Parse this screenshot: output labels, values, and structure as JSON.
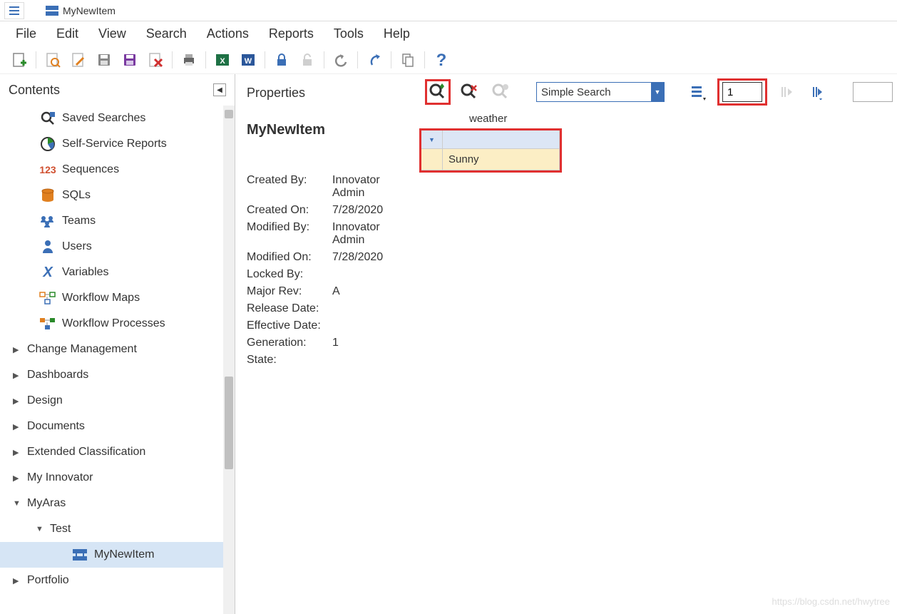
{
  "title": "MyNewItem",
  "menu": {
    "file": "File",
    "edit": "Edit",
    "view": "View",
    "search": "Search",
    "actions": "Actions",
    "reports": "Reports",
    "tools": "Tools",
    "help": "Help"
  },
  "left": {
    "header": "Contents",
    "items": [
      {
        "label": "Saved Searches",
        "kind": "item",
        "level": 1,
        "icon": "saved-search"
      },
      {
        "label": "Self-Service Reports",
        "kind": "item",
        "level": 1,
        "icon": "pie"
      },
      {
        "label": "Sequences",
        "kind": "item",
        "level": 1,
        "icon": "seq"
      },
      {
        "label": "SQLs",
        "kind": "item",
        "level": 1,
        "icon": "db"
      },
      {
        "label": "Teams",
        "kind": "item",
        "level": 1,
        "icon": "teams"
      },
      {
        "label": "Users",
        "kind": "item",
        "level": 1,
        "icon": "user"
      },
      {
        "label": "Variables",
        "kind": "item",
        "level": 1,
        "icon": "var"
      },
      {
        "label": "Workflow Maps",
        "kind": "item",
        "level": 1,
        "icon": "wfm"
      },
      {
        "label": "Workflow Processes",
        "kind": "item",
        "level": 1,
        "icon": "wfp"
      },
      {
        "label": "Change Management",
        "kind": "group",
        "level": 0,
        "caret": "▶"
      },
      {
        "label": "Dashboards",
        "kind": "group",
        "level": 0,
        "caret": "▶"
      },
      {
        "label": "Design",
        "kind": "group",
        "level": 0,
        "caret": "▶"
      },
      {
        "label": "Documents",
        "kind": "group",
        "level": 0,
        "caret": "▶"
      },
      {
        "label": "Extended Classification",
        "kind": "group",
        "level": 0,
        "caret": "▶"
      },
      {
        "label": "My Innovator",
        "kind": "group",
        "level": 0,
        "caret": "▶"
      },
      {
        "label": "MyAras",
        "kind": "group",
        "level": 0,
        "caret": "▼"
      },
      {
        "label": "Test",
        "kind": "group",
        "level": 2,
        "caret": "▼"
      },
      {
        "label": "MyNewItem",
        "kind": "item",
        "level": 4,
        "icon": "itemtype",
        "selected": true
      },
      {
        "label": "Portfolio",
        "kind": "group",
        "level": 0,
        "caret": "▶"
      }
    ]
  },
  "props": {
    "header": "Properties",
    "itemName": "MyNewItem",
    "rows": [
      {
        "k": "Created By:",
        "v": "Innovator Admin"
      },
      {
        "k": "Created On:",
        "v": "7/28/2020"
      },
      {
        "k": "Modified By:",
        "v": "Innovator Admin"
      },
      {
        "k": "Modified On:",
        "v": "7/28/2020"
      },
      {
        "k": "Locked By:",
        "v": ""
      },
      {
        "k": "Major Rev:",
        "v": "A"
      },
      {
        "k": "Release Date:",
        "v": ""
      },
      {
        "k": "Effective Date:",
        "v": ""
      },
      {
        "k": "Generation:",
        "v": "1"
      },
      {
        "k": "State:",
        "v": ""
      }
    ]
  },
  "grid": {
    "searchMode": "Simple Search",
    "pageValue": "1",
    "column": "weather",
    "rows": [
      {
        "weather": "Sunny"
      }
    ]
  },
  "watermark": "https://blog.csdn.net/hwytree"
}
